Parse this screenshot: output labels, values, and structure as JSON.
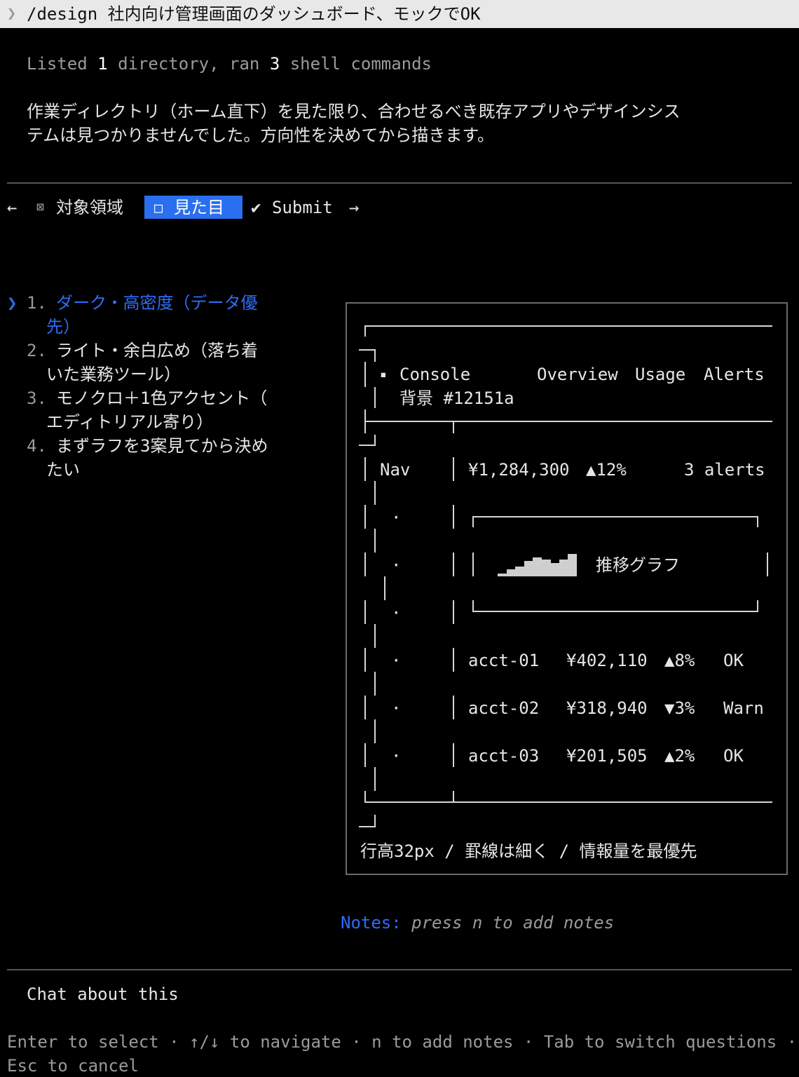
{
  "topbar": {
    "chevron": "❯",
    "command": "/design 社内向け管理画面のダッシュボード、モックでOK"
  },
  "status": {
    "listed": "Listed",
    "dir_count": "1",
    "directory": "directory, ran",
    "cmd_count": "3",
    "commands": "shell commands"
  },
  "message": {
    "line1": "作業ディレクトリ（ホーム直下）を見た限り、合わせるべき既存アプリやデザインシス",
    "line2": "テムは見つかりませんでした。方向性を決めてから描きます。"
  },
  "tabs": {
    "left_arrow": "←",
    "scope_check": "⊠",
    "scope": "対象領域",
    "visual_check": "□",
    "visual": "見た目",
    "submit_check": "✔",
    "submit": "Submit",
    "right_arrow": "→"
  },
  "options": {
    "cursor": "❯",
    "items": [
      {
        "num": "1.",
        "line1": "ダーク・高密度（データ優",
        "line2": "先）"
      },
      {
        "num": "2.",
        "line1": "ライト・余白広め（落ち着",
        "line2": "いた業務ツール）"
      },
      {
        "num": "3.",
        "line1": "モノクロ＋1色アクセント（",
        "line2": "エディトリアル寄り）"
      },
      {
        "num": "4.",
        "line1": "まずラフを3案見てから決め",
        "line2": "たい"
      }
    ]
  },
  "preview": {
    "brand_mark": "▪",
    "brand": "Console",
    "nav": [
      "Overview",
      "Usage",
      "Alerts"
    ],
    "bg_label": "背景 #12151a",
    "sidebar_label": "Nav",
    "sidebar_dots": [
      "·",
      "·",
      "·",
      "·",
      "·",
      "·"
    ],
    "kpi_value": "¥1,284,300",
    "kpi_change": "▲12%",
    "alerts": "3 alerts",
    "chart_label": "推移グラフ",
    "sparkline": [
      0.12,
      0.3,
      0.42,
      0.65,
      0.8,
      0.72,
      0.55,
      0.72,
      0.95
    ],
    "rows": [
      {
        "id": "acct-01",
        "amount": "¥402,110",
        "change": "▲8%",
        "status": "OK"
      },
      {
        "id": "acct-02",
        "amount": "¥318,940",
        "change": "▼3%",
        "status": "Warn"
      },
      {
        "id": "acct-03",
        "amount": "¥201,505",
        "change": "▲2%",
        "status": "OK"
      }
    ],
    "caption": "行高32px / 罫線は細く / 情報量を最優先"
  },
  "notes": {
    "label": "Notes:",
    "hint": "press n to add notes"
  },
  "chat": "Chat about this",
  "help": {
    "line1": "Enter to select · ↑/↓ to navigate · n to add notes · Tab to switch questions ·",
    "line2": "Esc to cancel"
  },
  "colors": {
    "accent": "#2f6cf6",
    "tab_active": "#2a6ff0",
    "background": "#000000",
    "topbar": "#e8e8e8"
  }
}
